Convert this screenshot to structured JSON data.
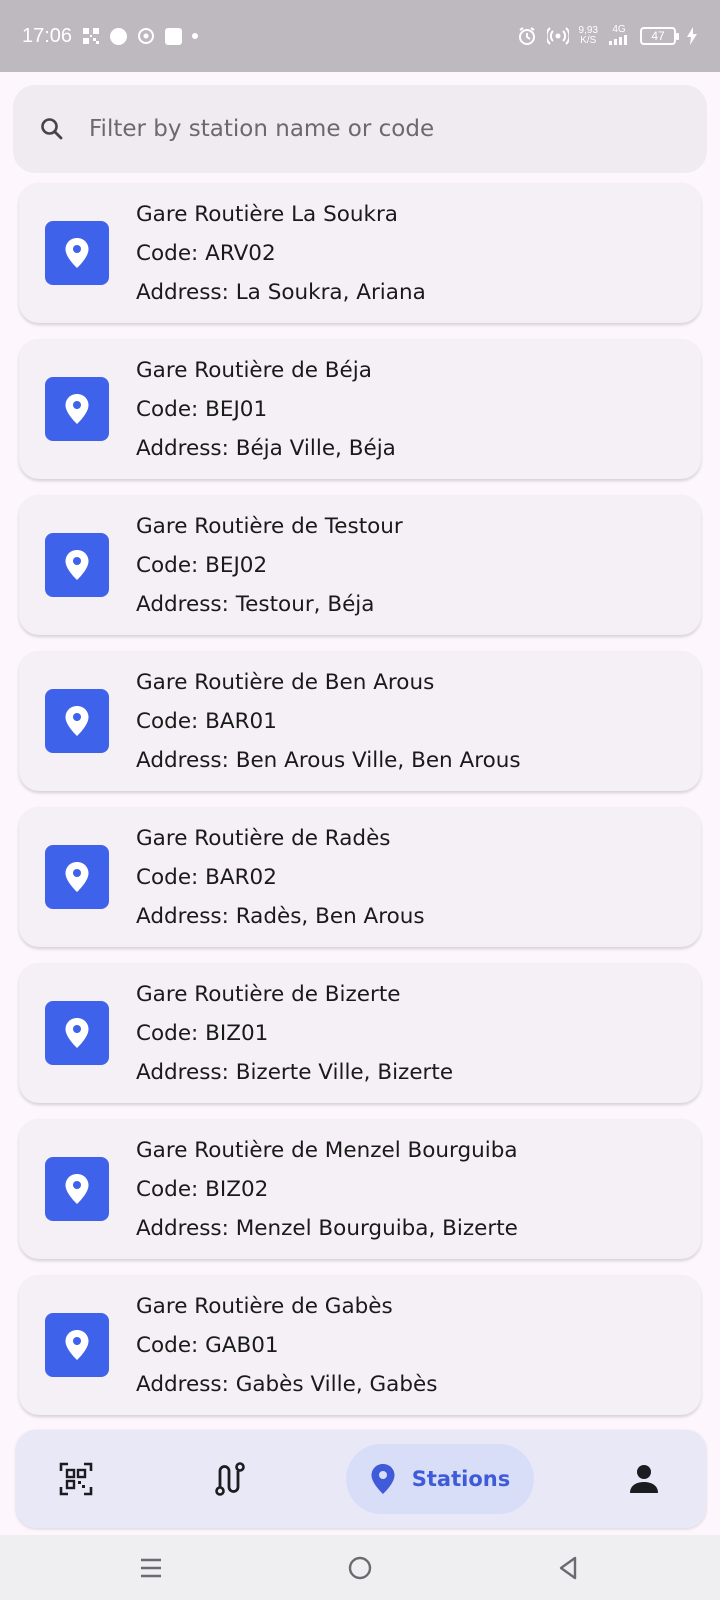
{
  "status_bar": {
    "time": "17:06",
    "net_speed_value": "9,93",
    "net_speed_unit": "K/S",
    "network": "4G",
    "battery": "47"
  },
  "search": {
    "placeholder": "Filter by station name or code",
    "value": ""
  },
  "stations": [
    {
      "name": "Gare Routière La Soukra",
      "code": "Code: ARV02",
      "address": "Address: La Soukra, Ariana"
    },
    {
      "name": "Gare Routière de Béja",
      "code": "Code: BEJ01",
      "address": "Address: Béja Ville, Béja"
    },
    {
      "name": "Gare Routière de Testour",
      "code": "Code: BEJ02",
      "address": "Address: Testour, Béja"
    },
    {
      "name": "Gare Routière de Ben Arous",
      "code": "Code: BAR01",
      "address": "Address: Ben Arous Ville, Ben Arous"
    },
    {
      "name": "Gare Routière de Radès",
      "code": "Code: BAR02",
      "address": "Address: Radès, Ben Arous"
    },
    {
      "name": "Gare Routière de Bizerte",
      "code": "Code: BIZ01",
      "address": "Address: Bizerte Ville, Bizerte"
    },
    {
      "name": "Gare Routière de Menzel Bourguiba",
      "code": "Code: BIZ02",
      "address": "Address: Menzel Bourguiba, Bizerte"
    },
    {
      "name": "Gare Routière de Gabès",
      "code": "Code: GAB01",
      "address": "Address: Gabès Ville, Gabès"
    }
  ],
  "bottom_nav": {
    "items": [
      {
        "icon": "qr-scan-icon",
        "label": ""
      },
      {
        "icon": "route-icon",
        "label": ""
      },
      {
        "icon": "location-pin-icon",
        "label": "Stations",
        "active": true
      },
      {
        "icon": "person-icon",
        "label": ""
      }
    ]
  },
  "colors": {
    "accent": "#3f62ea",
    "nav_active_bg": "#d9def8",
    "card_bg": "#f4f0f5",
    "status_bar_bg": "#bdb9bf"
  }
}
